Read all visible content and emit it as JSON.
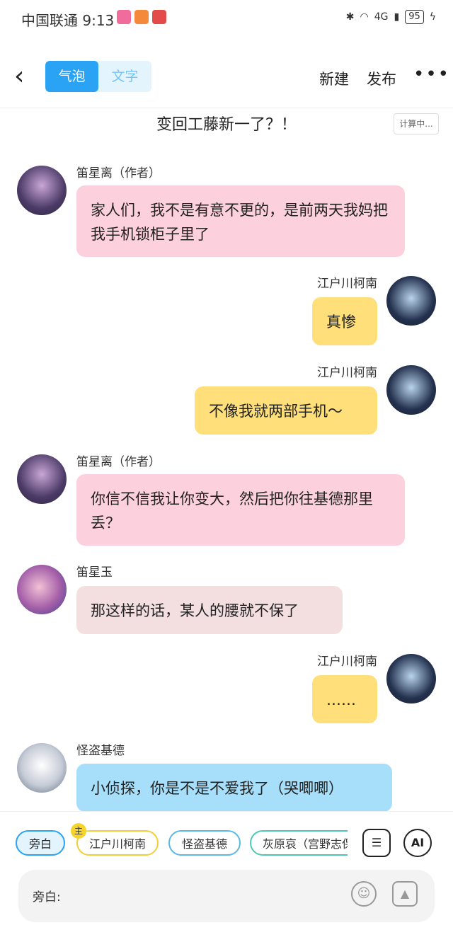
{
  "status": {
    "carrier_time": "中国联通 9:13",
    "battery": "95",
    "net": "4G"
  },
  "topbar": {
    "back": "‹",
    "tab_bubble": "气泡",
    "tab_text": "文字",
    "new": "新建",
    "publish": "发布",
    "more": "•••"
  },
  "title": "变回工藤新一了？！",
  "calc": "计算中...",
  "messages": [
    {
      "name": "笛星离（作者）",
      "text": "家人们，我不是有意不更的，是前两天我妈把我手机锁柜子里了"
    },
    {
      "name": "江户川柯南",
      "text": "真惨"
    },
    {
      "name": "江户川柯南",
      "text": "不像我就两部手机～"
    },
    {
      "name": "笛星离（作者）",
      "text": "你信不信我让你变大，然后把你往基德那里丢？"
    },
    {
      "name": "笛星玉",
      "text": "那这样的话，某人的腰就不保了"
    },
    {
      "name": "江户川柯南",
      "text": "……"
    },
    {
      "name": "怪盗基德",
      "text": "小侦探，你是不是不爱我了（哭唧唧）"
    }
  ],
  "characters": {
    "narration": "旁白",
    "main_badge": "主",
    "c1": "江户川柯南",
    "c2": "怪盗基德",
    "c3": "灰原哀（宫野志保）"
  },
  "tools": {
    "ai": "AI"
  },
  "input": {
    "label": "旁白:"
  }
}
